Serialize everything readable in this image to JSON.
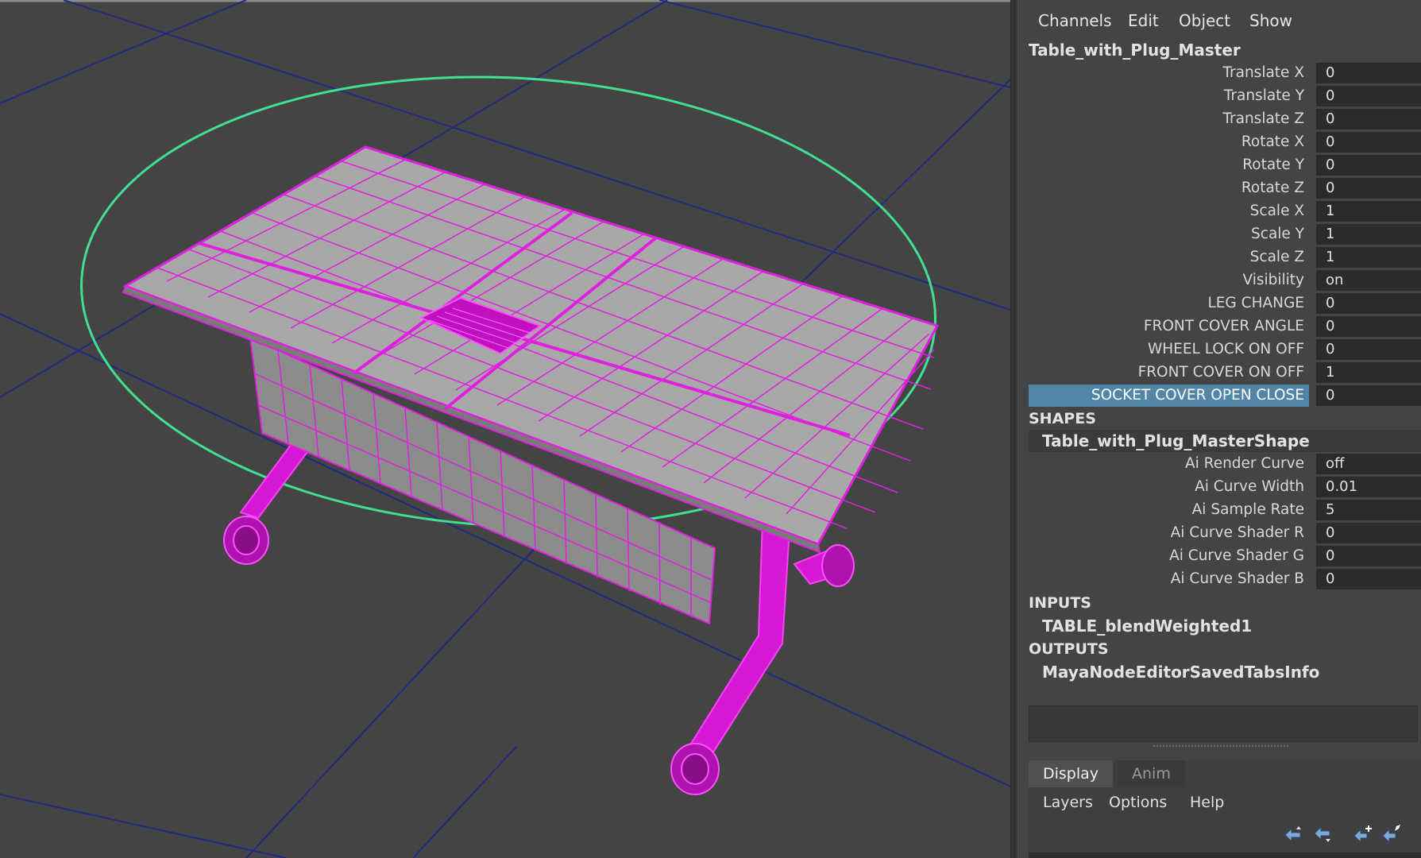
{
  "channel_box": {
    "menu": [
      "Channels",
      "Edit",
      "Object",
      "Show"
    ],
    "node_name": "Table_with_Plug_Master",
    "attributes": [
      {
        "label": "Translate X",
        "value": "0"
      },
      {
        "label": "Translate Y",
        "value": "0"
      },
      {
        "label": "Translate Z",
        "value": "0"
      },
      {
        "label": "Rotate X",
        "value": "0"
      },
      {
        "label": "Rotate Y",
        "value": "0"
      },
      {
        "label": "Rotate Z",
        "value": "0"
      },
      {
        "label": "Scale X",
        "value": "1"
      },
      {
        "label": "Scale Y",
        "value": "1"
      },
      {
        "label": "Scale Z",
        "value": "1"
      },
      {
        "label": "Visibility",
        "value": "on"
      },
      {
        "label": "LEG CHANGE",
        "value": "0"
      },
      {
        "label": "FRONT COVER ANGLE",
        "value": "0"
      },
      {
        "label": "WHEEL LOCK ON OFF",
        "value": "0"
      },
      {
        "label": "FRONT COVER ON OFF",
        "value": "1"
      },
      {
        "label": "SOCKET COVER OPEN CLOSE",
        "value": "0",
        "selected": true
      }
    ],
    "shapes": {
      "heading": "SHAPES",
      "name": "Table_with_Plug_MasterShape",
      "attributes": [
        {
          "label": "Ai Render Curve",
          "value": "off"
        },
        {
          "label": "Ai Curve Width",
          "value": "0.01"
        },
        {
          "label": "Ai Sample Rate",
          "value": "5"
        },
        {
          "label": "Ai Curve Shader R",
          "value": "0"
        },
        {
          "label": "Ai Curve Shader G",
          "value": "0"
        },
        {
          "label": "Ai Curve Shader B",
          "value": "0"
        }
      ]
    },
    "inputs": {
      "heading": "INPUTS",
      "items": [
        "TABLE_blendWeighted1"
      ]
    },
    "outputs": {
      "heading": "OUTPUTS",
      "items": [
        "MayaNodeEditorSavedTabsInfo"
      ]
    }
  },
  "layer_editor": {
    "tabs": [
      "Display",
      "Anim"
    ],
    "active_tab": "Display",
    "menu": [
      "Layers",
      "Options",
      "Help"
    ],
    "tool_icons": [
      "move-layer-up-icon",
      "move-layer-down-icon",
      "new-empty-layer-icon",
      "new-layer-from-selection-icon"
    ]
  },
  "viewport": {
    "object": "table",
    "wireframe_color": "#e020e0",
    "control_curve_color": "#40e090",
    "grid_line_color": "#1f2a80",
    "background_color": "#444444"
  }
}
